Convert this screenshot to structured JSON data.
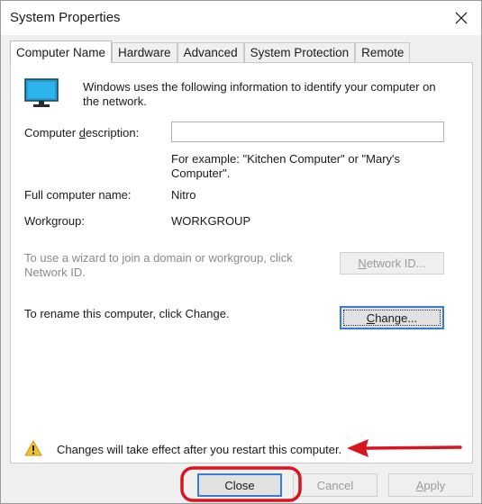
{
  "window": {
    "title": "System Properties"
  },
  "tabs": [
    {
      "label": "Computer Name",
      "active": true
    },
    {
      "label": "Hardware",
      "active": false
    },
    {
      "label": "Advanced",
      "active": false
    },
    {
      "label": "System Protection",
      "active": false
    },
    {
      "label": "Remote",
      "active": false
    }
  ],
  "info": {
    "line1": "Windows uses the following information to identify your computer on",
    "line2": "the network."
  },
  "description": {
    "label_pre": "Computer ",
    "label_ul": "d",
    "label_post": "escription:",
    "value": "",
    "hint_line1": "For example: \"Kitchen Computer\" or \"Mary's",
    "hint_line2": "Computer\"."
  },
  "full_name": {
    "label": "Full computer name:",
    "value": "Nitro"
  },
  "workgroup": {
    "label": "Workgroup:",
    "value": "WORKGROUP"
  },
  "network": {
    "line1": "To use a wizard to join a domain or workgroup, click",
    "line2": "Network ID.",
    "button_ul": "N",
    "button_rest": "etwork ID..."
  },
  "rename": {
    "text": "To rename this computer, click Change.",
    "button_ul": "C",
    "button_rest": "hange..."
  },
  "warning": {
    "text": "Changes will take effect after you restart this computer."
  },
  "buttons": {
    "close": "Close",
    "cancel": "Cancel",
    "apply_ul": "A",
    "apply_rest": "pply"
  },
  "colors": {
    "annotation": "#d9141f",
    "monitor": "#1f9fd6"
  }
}
